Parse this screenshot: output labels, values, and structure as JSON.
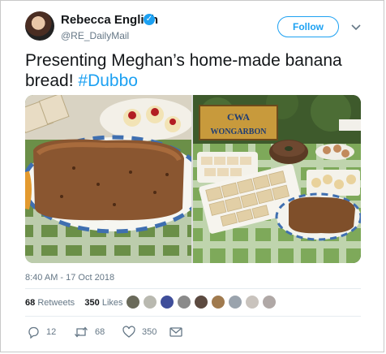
{
  "tweet": {
    "author": {
      "display_name": "Rebecca English",
      "handle": "@RE_DailyMail",
      "verified": true
    },
    "follow_label": "Follow",
    "text_main": "Presenting Meghan’s home-made banana bread!",
    "hashtag": "#Dubbo",
    "timestamp": "8:40 AM - 17 Oct 2018",
    "stats": {
      "retweets_count": "68",
      "retweets_label": "Retweets",
      "likes_count": "350",
      "likes_label": "Likes"
    },
    "actions": {
      "replies": "12",
      "retweets": "68",
      "likes": "350"
    },
    "photo_right_sign": {
      "line1": "CWA",
      "line2": "WONGARBON"
    }
  },
  "colors": {
    "brand_blue": "#1da1f2",
    "secondary_text": "#657786",
    "primary_text": "#14171a",
    "divider": "#e6ecf0"
  },
  "icons": {
    "verified": "verified-badge-icon",
    "chevron": "chevron-down-icon",
    "reply": "reply-icon",
    "retweet": "retweet-icon",
    "like": "heart-icon",
    "dm": "envelope-icon"
  }
}
